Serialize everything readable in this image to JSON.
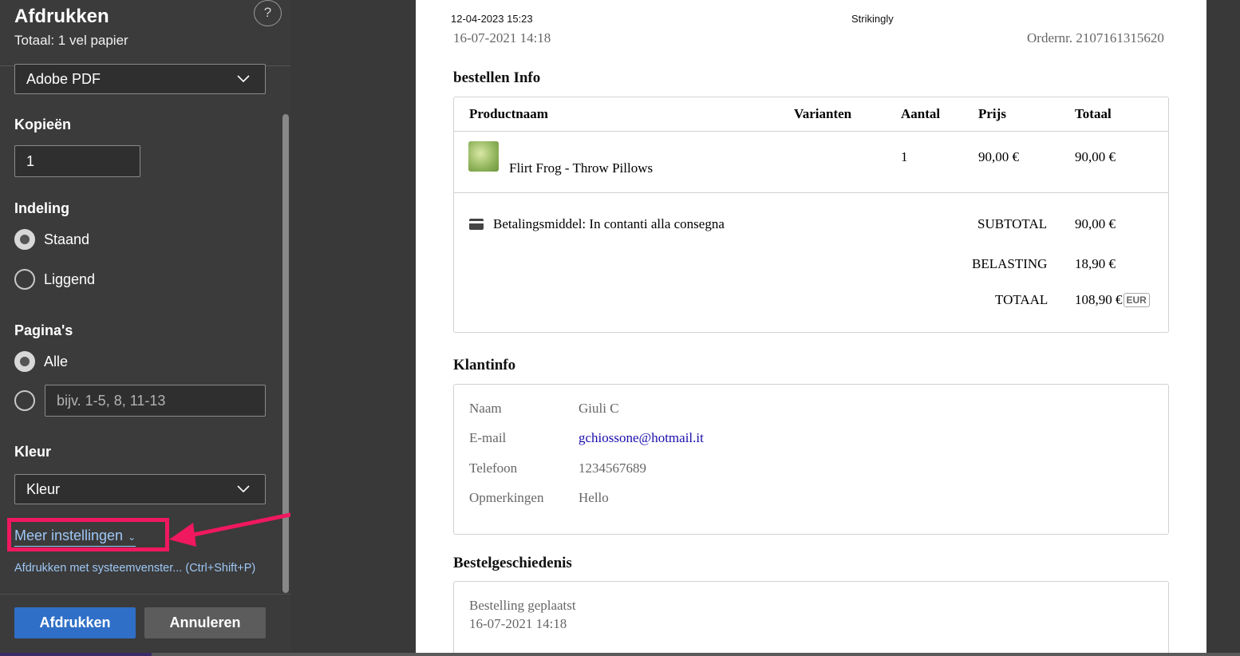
{
  "dialog": {
    "title": "Afdrukken",
    "subtitle": "Totaal: 1 vel papier",
    "help": "?",
    "printer": "Adobe PDF",
    "copies_label": "Kopieën",
    "copies_value": "1",
    "layout_label": "Indeling",
    "layout_options": [
      "Staand",
      "Liggend"
    ],
    "pages_label": "Pagina's",
    "pages_all": "Alle",
    "pages_placeholder": "bijv. 1-5, 8, 11-13",
    "color_label": "Kleur",
    "color_value": "Kleur",
    "more_settings": "Meer instellingen",
    "system_dialog": "Afdrukken met systeemvenster... (Ctrl+Shift+P)",
    "print_button": "Afdrukken",
    "cancel_button": "Annuleren"
  },
  "page": {
    "print_timestamp": "12-04-2023 15:23",
    "site_name": "Strikingly",
    "order_date": "16-07-2021 14:18",
    "order_number": "Ordernr. 2107161315620",
    "order_info_title": "bestellen Info",
    "columns": [
      "Productnaam",
      "Varianten",
      "Aantal",
      "Prijs",
      "Totaal"
    ],
    "item": {
      "name": "Flirt Frog - Throw Pillows",
      "variants": "",
      "quantity": "1",
      "price": "90,00 €",
      "total": "90,00 €"
    },
    "payment": "Betalingsmiddel: In contanti alla consegna",
    "subtotal_label": "SUBTOTAL",
    "subtotal_value": "90,00 €",
    "tax_label": "BELASTING",
    "tax_value": "18,90 €",
    "total_label": "TOTAAL",
    "total_value": "108,90 €",
    "currency": "EUR",
    "customer_title": "Klantinfo",
    "customer": {
      "name_label": "Naam",
      "name": "Giuli C",
      "email_label": "E-mail",
      "email": "gchiossone@hotmail.it",
      "phone_label": "Telefoon",
      "phone": "1234567689",
      "notes_label": "Opmerkingen",
      "notes": "Hello"
    },
    "history_title": "Bestelgeschiedenis",
    "history_event": "Bestelling geplaatst",
    "history_date": "16-07-2021 14:18"
  },
  "colors": {
    "panel": "#3b3b3b",
    "accent": "#2f6fc7",
    "link": "#9ec7f5",
    "annotation": "#f0185f"
  }
}
